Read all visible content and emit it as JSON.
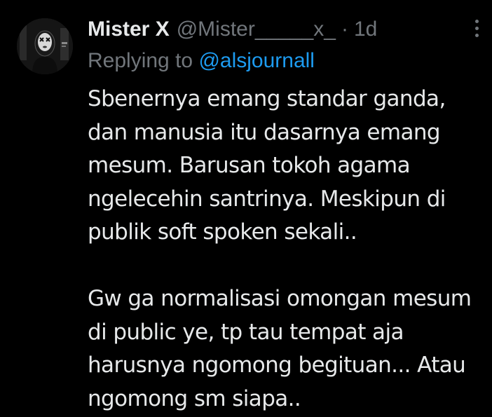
{
  "tweet": {
    "display_name": "Mister X",
    "handle": "@Mister_____x_",
    "separator": "·",
    "time": "1d",
    "more_icon": "more-vertical-icon",
    "replying_prefix": "Replying to",
    "replying_to": "@alsjournall",
    "paragraph1": [
      "Sbenernya emang standar ganda,",
      "dan manusia itu dasarnya emang",
      "mesum. Barusan tokoh agama",
      "ngelecehin santrinya. Meskipun di",
      "publik soft spoken sekali.."
    ],
    "paragraph2": [
      "Gw ga normalisasi omongan mesum",
      "di public ye, tp tau tempat aja",
      "harusnya ngomong begituan... Atau",
      "ngomong sm siapa.."
    ]
  },
  "colors": {
    "background": "#000000",
    "primary_text": "#e7e9ea",
    "secondary_text": "#71767b",
    "accent": "#1d9bf0"
  }
}
